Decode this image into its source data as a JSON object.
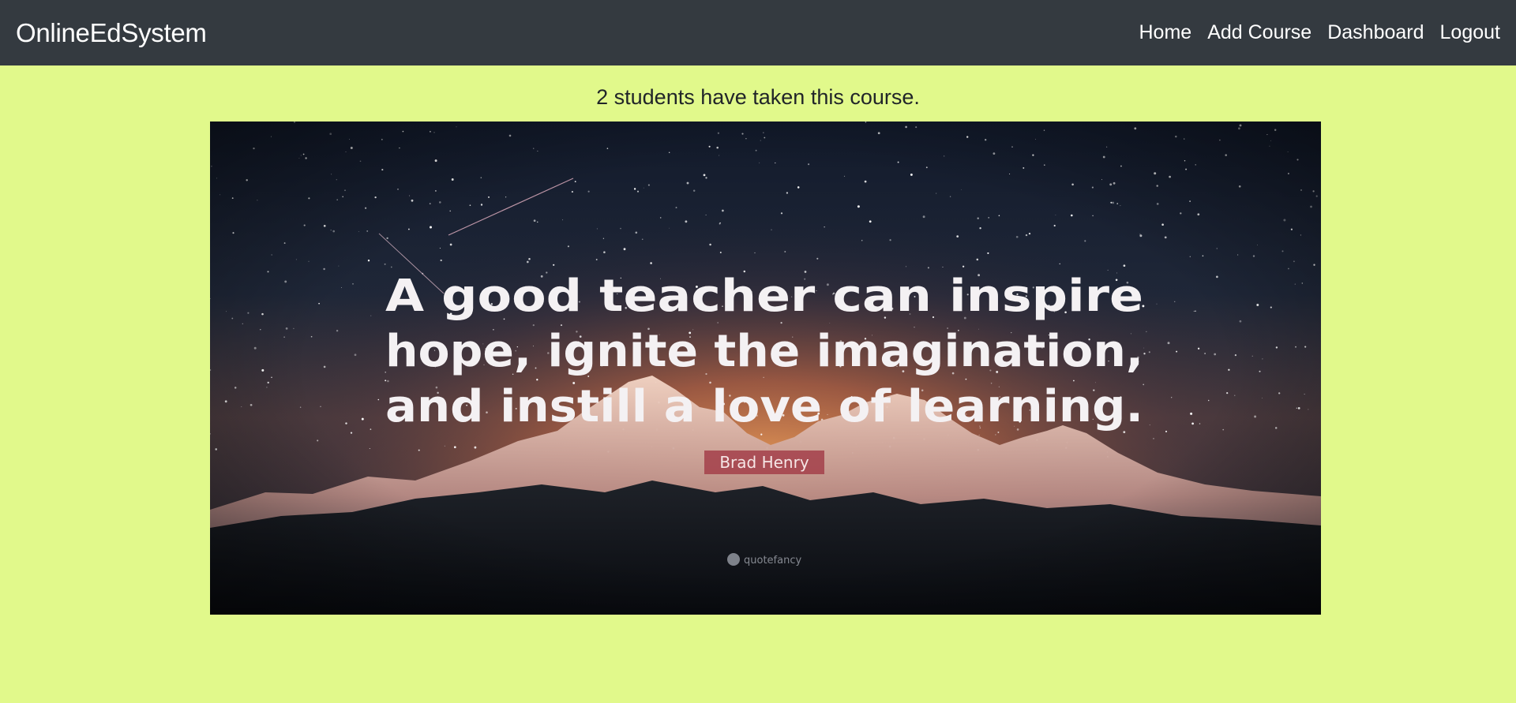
{
  "navbar": {
    "brand": "OnlineEdSystem",
    "links": [
      {
        "label": "Home"
      },
      {
        "label": "Add Course"
      },
      {
        "label": "Dashboard"
      },
      {
        "label": "Logout"
      }
    ]
  },
  "main": {
    "students_text": "2 students have taken this course.",
    "banner": {
      "quote_lines": [
        "A good teacher can inspire",
        "hope, ignite the imagination,",
        "and instill a love of learning."
      ],
      "author": "Brad Henry",
      "watermark": "quotefancy"
    }
  },
  "colors": {
    "page_background": "#e1f98b",
    "navbar_background": "#343a40",
    "author_tag": "#a3404a"
  }
}
